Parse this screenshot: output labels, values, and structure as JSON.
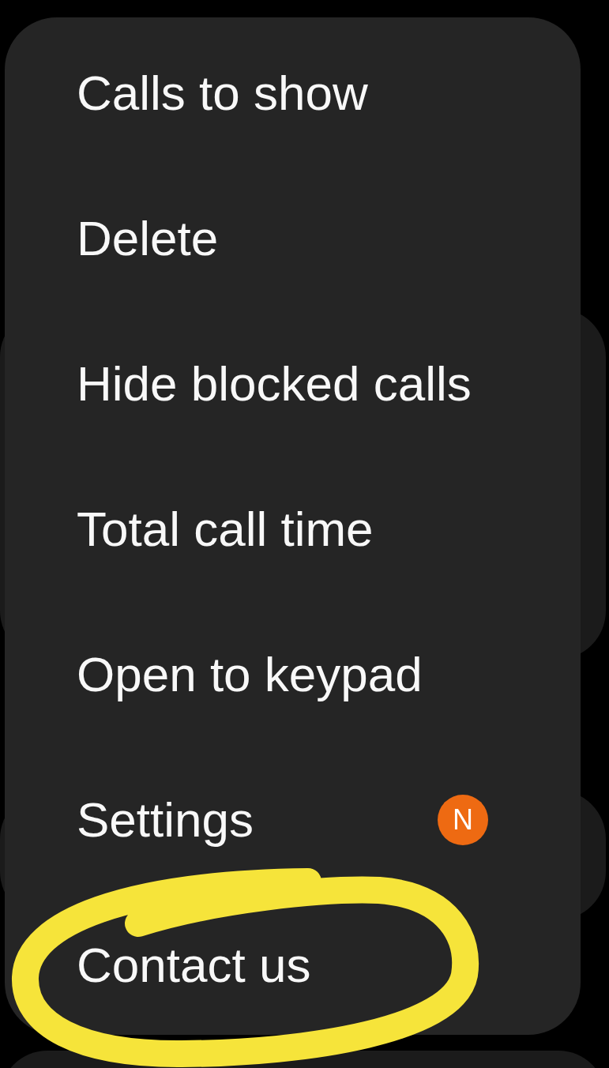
{
  "menu": {
    "items": [
      {
        "label": "Calls to show",
        "circled": false
      },
      {
        "label": "Delete",
        "circled": false
      },
      {
        "label": "Hide blocked calls",
        "circled": false
      },
      {
        "label": "Total call time",
        "circled": false
      },
      {
        "label": "Open to keypad",
        "circled": false
      },
      {
        "label": "Settings",
        "badge": "N",
        "circled": false
      },
      {
        "label": "Contact us",
        "circled": true
      }
    ]
  }
}
